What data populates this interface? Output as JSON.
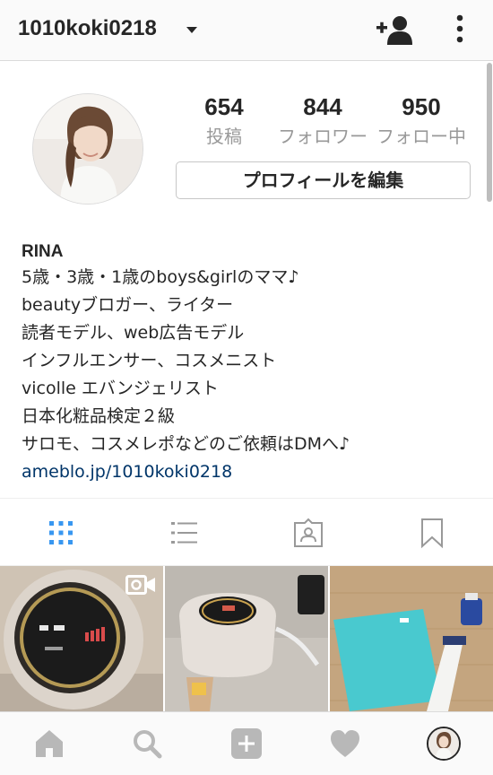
{
  "header": {
    "username": "1010koki0218",
    "icons": {
      "dropdown": "chevron-down-icon",
      "add_user": "add-user-icon",
      "more": "more-vertical-icon"
    }
  },
  "profile": {
    "stats": [
      {
        "value": "654",
        "label": "投稿"
      },
      {
        "value": "844",
        "label": "フォロワー"
      },
      {
        "value": "950",
        "label": "フォロー中"
      }
    ],
    "edit_button": "プロフィールを編集"
  },
  "bio": {
    "name": "RINA",
    "lines": [
      "5歳・3歳・1歳のboys&girlのママ♪",
      "beautyブロガー、ライター",
      "読者モデル、web広告モデル",
      "インフルエンサー、コスメニスト",
      "vicolle エバンジェリスト",
      "日本化粧品検定２級",
      "サロモ、コスメレポなどのご依頼はDMへ♪"
    ],
    "link": "ameblo.jp/1010koki0218"
  },
  "tabs": [
    {
      "icon": "grid-icon",
      "active": true
    },
    {
      "icon": "list-icon",
      "active": false
    },
    {
      "icon": "tagged-icon",
      "active": false
    },
    {
      "icon": "bookmark-icon",
      "active": false
    }
  ],
  "posts": [
    {
      "kind": "video",
      "icon": "video-camera-icon"
    },
    {
      "kind": "photo"
    },
    {
      "kind": "photo"
    }
  ],
  "bottom_nav": [
    "home-icon",
    "search-icon",
    "add-post-icon",
    "heart-icon",
    "profile-avatar"
  ],
  "colors": {
    "accent": "#3897f0",
    "link": "#003569",
    "text": "#262626",
    "muted": "#999999",
    "nav_inactive": "#b8b8b8",
    "border": "#dbdbdb"
  }
}
